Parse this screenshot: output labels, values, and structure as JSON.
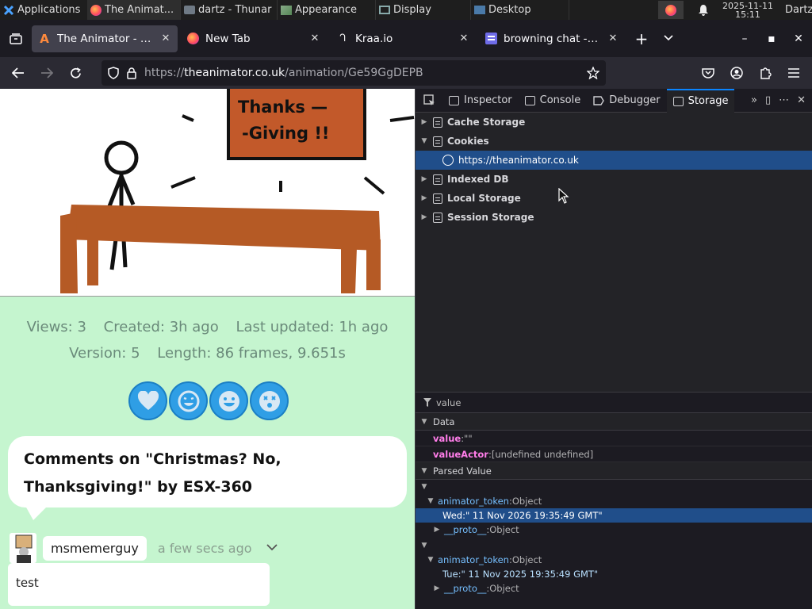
{
  "taskbar": {
    "apps_label": "Applications",
    "windows": [
      {
        "label": "The Animat..."
      },
      {
        "label": "dartz - Thunar"
      },
      {
        "label": "Appearance"
      },
      {
        "label": "Display"
      },
      {
        "label": "Desktop"
      }
    ],
    "clock_date": "2025-11-11",
    "clock_time": "15:11",
    "user": "Dartz"
  },
  "tabs": [
    {
      "label": "The Animator - Christmas",
      "favicon": "animator-a-icon"
    },
    {
      "label": "New Tab",
      "favicon": "firefox-icon"
    },
    {
      "label": "Kraa.io",
      "favicon": "kraa-icon"
    },
    {
      "label": "browning chat - chat",
      "favicon": "chat-icon"
    }
  ],
  "navbar": {
    "url_scheme": "https://",
    "url_host": "theanimator.co.uk",
    "url_path": "/animation/Ge59GgDEPB"
  },
  "page": {
    "animation_text_1": "Thanks —",
    "animation_text_2": "-Giving !!",
    "views": "Views: 3",
    "created": "Created: 3h ago",
    "updated": "Last updated: 1h ago",
    "version": "Version: 5",
    "length": "Length: 86 frames, 9.651s",
    "comments_heading_1": "Comments on \"Christmas? No,",
    "comments_heading_2": "Thanksgiving!\" by ESX-360",
    "comment": {
      "username": "msmemerguy",
      "time": "a few secs ago",
      "body": "test"
    }
  },
  "devtools": {
    "tabs": {
      "inspector": "Inspector",
      "console": "Console",
      "debugger": "Debugger",
      "storage": "Storage"
    },
    "tree": {
      "cache": "Cache Storage",
      "cookies": "Cookies",
      "cookie_host": "https://theanimator.co.uk",
      "indexed": "Indexed DB",
      "local": "Local Storage",
      "session": "Session Storage"
    },
    "sidebar": {
      "filter": "value",
      "data_heading": "Data",
      "value_key": "value",
      "value_val": ":\"\"",
      "actor_key": "valueActor",
      "actor_val": ":[undefined undefined]",
      "parsed_heading": "Parsed Value",
      "token_1_key": "animator_token",
      "token_1_type": ":Object",
      "token_1_date": "Wed:\" 11 Nov 2026 19:35:49 GMT\"",
      "proto_1": "__proto__",
      "proto_1_type": ":Object",
      "token_2_key": "animator_token",
      "token_2_type": ":Object",
      "token_2_date": "Tue:\" 11 Nov 2025 19:35:49 GMT\"",
      "proto_2": "__proto__",
      "proto_2_type": ":Object"
    }
  }
}
